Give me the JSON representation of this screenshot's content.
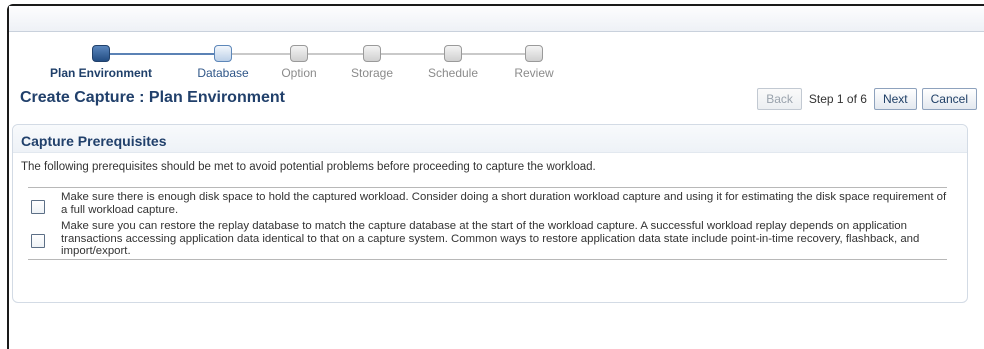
{
  "train": {
    "steps": [
      {
        "label": "Plan Environment",
        "state": "current"
      },
      {
        "label": "Database",
        "state": "next"
      },
      {
        "label": "Option",
        "state": "todo"
      },
      {
        "label": "Storage",
        "state": "todo"
      },
      {
        "label": "Schedule",
        "state": "todo"
      },
      {
        "label": "Review",
        "state": "todo"
      }
    ]
  },
  "header": {
    "title": "Create Capture : Plan Environment",
    "back_label": "Back",
    "step_text": "Step 1 of 6",
    "next_label": "Next",
    "cancel_label": "Cancel"
  },
  "panel": {
    "title": "Capture Prerequisites",
    "description": "The following prerequisites should be met to avoid potential problems before proceeding to capture the workload.",
    "items": [
      {
        "text": "Make sure there is enough disk space to hold the captured workload. Consider doing a short duration workload capture and using it for estimating the disk space requirement of a full workload capture.",
        "checked": false
      },
      {
        "text": "Make sure you can restore the replay database to match the capture database at the start of the workload capture. A successful workload replay depends on application transactions accessing application data identical to that on a capture system. Common ways to restore application data state include point-in-time recovery, flashback, and import/export.",
        "checked": false
      }
    ]
  }
}
